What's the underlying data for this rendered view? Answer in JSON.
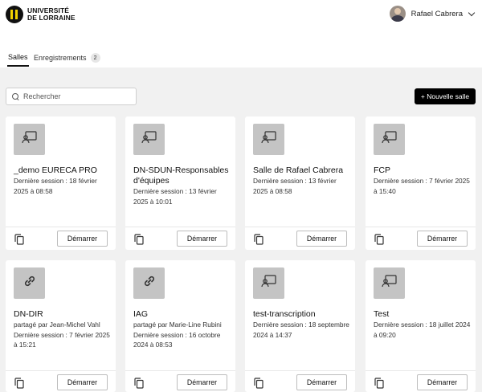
{
  "header": {
    "logo_line1": "UNIVERSITÉ",
    "logo_line2": "DE LORRAINE",
    "user_name": "Rafael Cabrera"
  },
  "tabs": [
    {
      "label": "Salles"
    },
    {
      "label": "Enregistrements",
      "count": "2"
    }
  ],
  "search": {
    "placeholder": "Rechercher"
  },
  "new_room_label": "+ Nouvelle salle",
  "start_label": "Démarrer",
  "rooms": [
    {
      "name": "_demo EURECA PRO",
      "shared_by": "",
      "last_session": "Dernière session : 18 février 2025 à 08:58",
      "icon": "room-icon"
    },
    {
      "name": "DN-SDUN-Responsables d'équipes",
      "shared_by": "",
      "last_session": "Dernière session : 13 février 2025 à 10:01",
      "icon": "room-icon"
    },
    {
      "name": "Salle de Rafael Cabrera",
      "shared_by": "",
      "last_session": "Dernière session : 13 février 2025 à 08:58",
      "icon": "room-icon"
    },
    {
      "name": "FCP",
      "shared_by": "",
      "last_session": "Dernière session : 7 février 2025 à 15:40",
      "icon": "room-icon"
    },
    {
      "name": "DN-DIR",
      "shared_by": "partagé par Jean-Michel Vahl",
      "last_session": "Dernière session : 7 février 2025 à 15:21",
      "icon": "link-icon"
    },
    {
      "name": "IAG",
      "shared_by": "partagé par Marie-Line Rubini",
      "last_session": "Dernière session : 16 octobre 2024 à 08:53",
      "icon": "link-icon"
    },
    {
      "name": "test-transcription",
      "shared_by": "",
      "last_session": "Dernière session : 18 septembre 2024 à 14:37",
      "icon": "room-icon"
    },
    {
      "name": "Test",
      "shared_by": "",
      "last_session": "Dernière session : 18 juillet 2024 à 09:20",
      "icon": "room-icon"
    }
  ]
}
